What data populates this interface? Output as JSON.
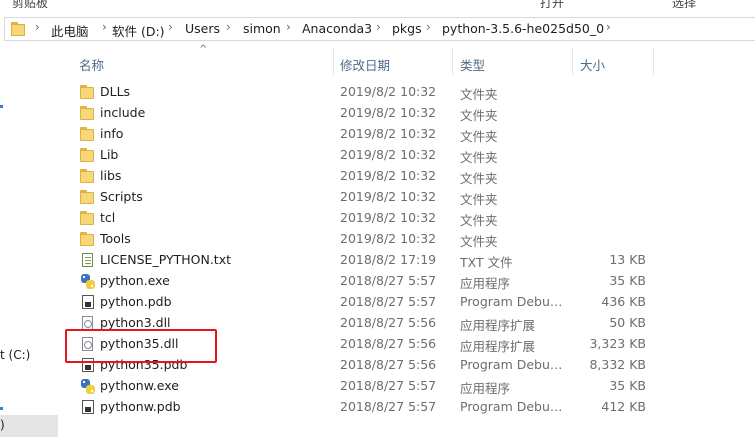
{
  "ribbon": {
    "left_label": "剪贴板",
    "right_label_1": "打开",
    "right_label_2": "选择"
  },
  "breadcrumb": [
    "此电脑",
    "软件 (D:)",
    "Users",
    "simon",
    "Anaconda3",
    "pkgs",
    "python-3.5.6-he025d50_0"
  ],
  "nav": {
    "drive_label": "t (C:)",
    "selected_label": ")"
  },
  "columns": {
    "name": "名称",
    "date": "修改日期",
    "type": "类型",
    "size": "大小"
  },
  "files": [
    {
      "name": "DLLs",
      "date": "2019/8/2 10:32",
      "type": "文件夹",
      "size": "",
      "icon": "folder-icon"
    },
    {
      "name": "include",
      "date": "2019/8/2 10:32",
      "type": "文件夹",
      "size": "",
      "icon": "folder-icon"
    },
    {
      "name": "info",
      "date": "2019/8/2 10:32",
      "type": "文件夹",
      "size": "",
      "icon": "folder-icon"
    },
    {
      "name": "Lib",
      "date": "2019/8/2 10:32",
      "type": "文件夹",
      "size": "",
      "icon": "folder-icon"
    },
    {
      "name": "libs",
      "date": "2019/8/2 10:32",
      "type": "文件夹",
      "size": "",
      "icon": "folder-icon"
    },
    {
      "name": "Scripts",
      "date": "2019/8/2 10:32",
      "type": "文件夹",
      "size": "",
      "icon": "folder-icon"
    },
    {
      "name": "tcl",
      "date": "2019/8/2 10:32",
      "type": "文件夹",
      "size": "",
      "icon": "folder-icon"
    },
    {
      "name": "Tools",
      "date": "2019/8/2 10:32",
      "type": "文件夹",
      "size": "",
      "icon": "folder-icon"
    },
    {
      "name": "LICENSE_PYTHON.txt",
      "date": "2018/8/2 17:19",
      "type": "TXT 文件",
      "size": "13 KB",
      "icon": "text-file-icon"
    },
    {
      "name": "python.exe",
      "date": "2018/8/27 5:57",
      "type": "应用程序",
      "size": "35 KB",
      "icon": "python-icon"
    },
    {
      "name": "python.pdb",
      "date": "2018/8/27 5:57",
      "type": "Program Debug...",
      "size": "436 KB",
      "icon": "pdb-file-icon"
    },
    {
      "name": "python3.dll",
      "date": "2018/8/27 5:56",
      "type": "应用程序扩展",
      "size": "50 KB",
      "icon": "dll-file-icon"
    },
    {
      "name": "python35.dll",
      "date": "2018/8/27 5:56",
      "type": "应用程序扩展",
      "size": "3,323 KB",
      "icon": "dll-file-icon"
    },
    {
      "name": "python35.pdb",
      "date": "2018/8/27 5:56",
      "type": "Program Debug...",
      "size": "8,332 KB",
      "icon": "pdb-file-icon"
    },
    {
      "name": "pythonw.exe",
      "date": "2018/8/27 5:57",
      "type": "应用程序",
      "size": "35 KB",
      "icon": "python-icon"
    },
    {
      "name": "pythonw.pdb",
      "date": "2018/8/27 5:57",
      "type": "Program Debug...",
      "size": "412 KB",
      "icon": "pdb-file-icon"
    }
  ],
  "highlighted_file": "python35.dll",
  "colors": {
    "highlight": "#e8151c",
    "header_text": "#4d6b8a",
    "folder": "#f8d775"
  }
}
